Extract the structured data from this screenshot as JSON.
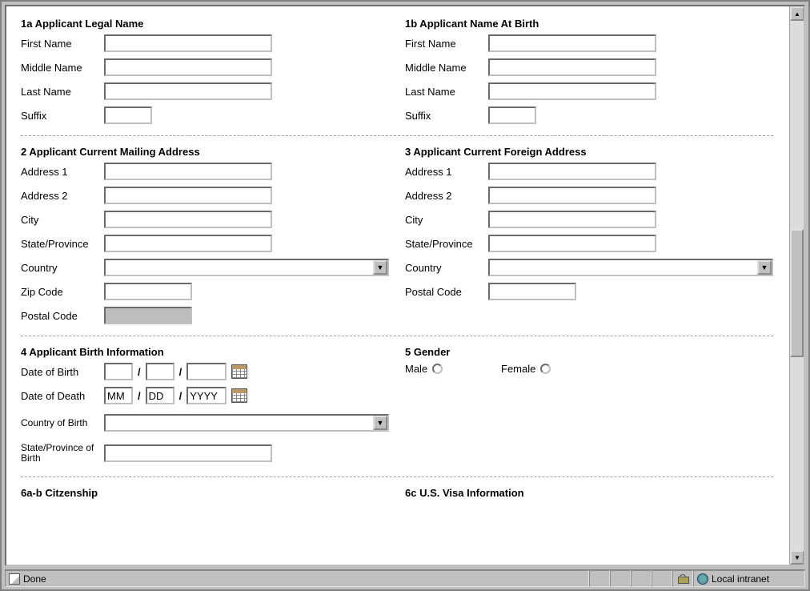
{
  "sections": {
    "s1a": {
      "title": "1a Applicant Legal Name",
      "first": {
        "label": "First Name",
        "value": ""
      },
      "middle": {
        "label": "Middle Name",
        "value": ""
      },
      "last": {
        "label": "Last Name",
        "value": ""
      },
      "suffix": {
        "label": "Suffix",
        "value": ""
      }
    },
    "s1b": {
      "title": "1b Applicant Name At Birth",
      "first": {
        "label": "First Name",
        "value": ""
      },
      "middle": {
        "label": "Middle Name",
        "value": ""
      },
      "last": {
        "label": "Last Name",
        "value": ""
      },
      "suffix": {
        "label": "Suffix",
        "value": ""
      }
    },
    "s2": {
      "title": "2 Applicant Current Mailing Address",
      "addr1": {
        "label": "Address 1",
        "value": ""
      },
      "addr2": {
        "label": "Address 2",
        "value": ""
      },
      "city": {
        "label": "City",
        "value": ""
      },
      "state": {
        "label": "State/Province",
        "value": ""
      },
      "country": {
        "label": "Country",
        "value": ""
      },
      "zip": {
        "label": "Zip Code",
        "value": ""
      },
      "postal": {
        "label": "Postal Code",
        "value": ""
      }
    },
    "s3": {
      "title": "3 Applicant Current Foreign Address",
      "addr1": {
        "label": "Address 1",
        "value": ""
      },
      "addr2": {
        "label": "Address 2",
        "value": ""
      },
      "city": {
        "label": "City",
        "value": ""
      },
      "state": {
        "label": "State/Province",
        "value": ""
      },
      "country": {
        "label": "Country",
        "value": ""
      },
      "postal": {
        "label": "Postal Code",
        "value": ""
      }
    },
    "s4": {
      "title": "4 Applicant Birth Information",
      "dob": {
        "label": "Date of Birth",
        "mm": "",
        "dd": "",
        "yyyy": ""
      },
      "dod": {
        "label": "Date of Death",
        "mm": "MM",
        "dd": "DD",
        "yyyy": "YYYY"
      },
      "cob": {
        "label": "Country of Birth",
        "value": ""
      },
      "spob": {
        "label": "State/Province of Birth",
        "value": ""
      }
    },
    "s5": {
      "title": "5 Gender",
      "male": {
        "label": "Male",
        "checked": false
      },
      "female": {
        "label": "Female",
        "checked": false
      }
    },
    "s6ab": {
      "title": "6a-b Citzenship"
    },
    "s6c": {
      "title": "6c U.S. Visa Information"
    }
  },
  "status": {
    "text": "Done",
    "zone": "Local intranet"
  }
}
